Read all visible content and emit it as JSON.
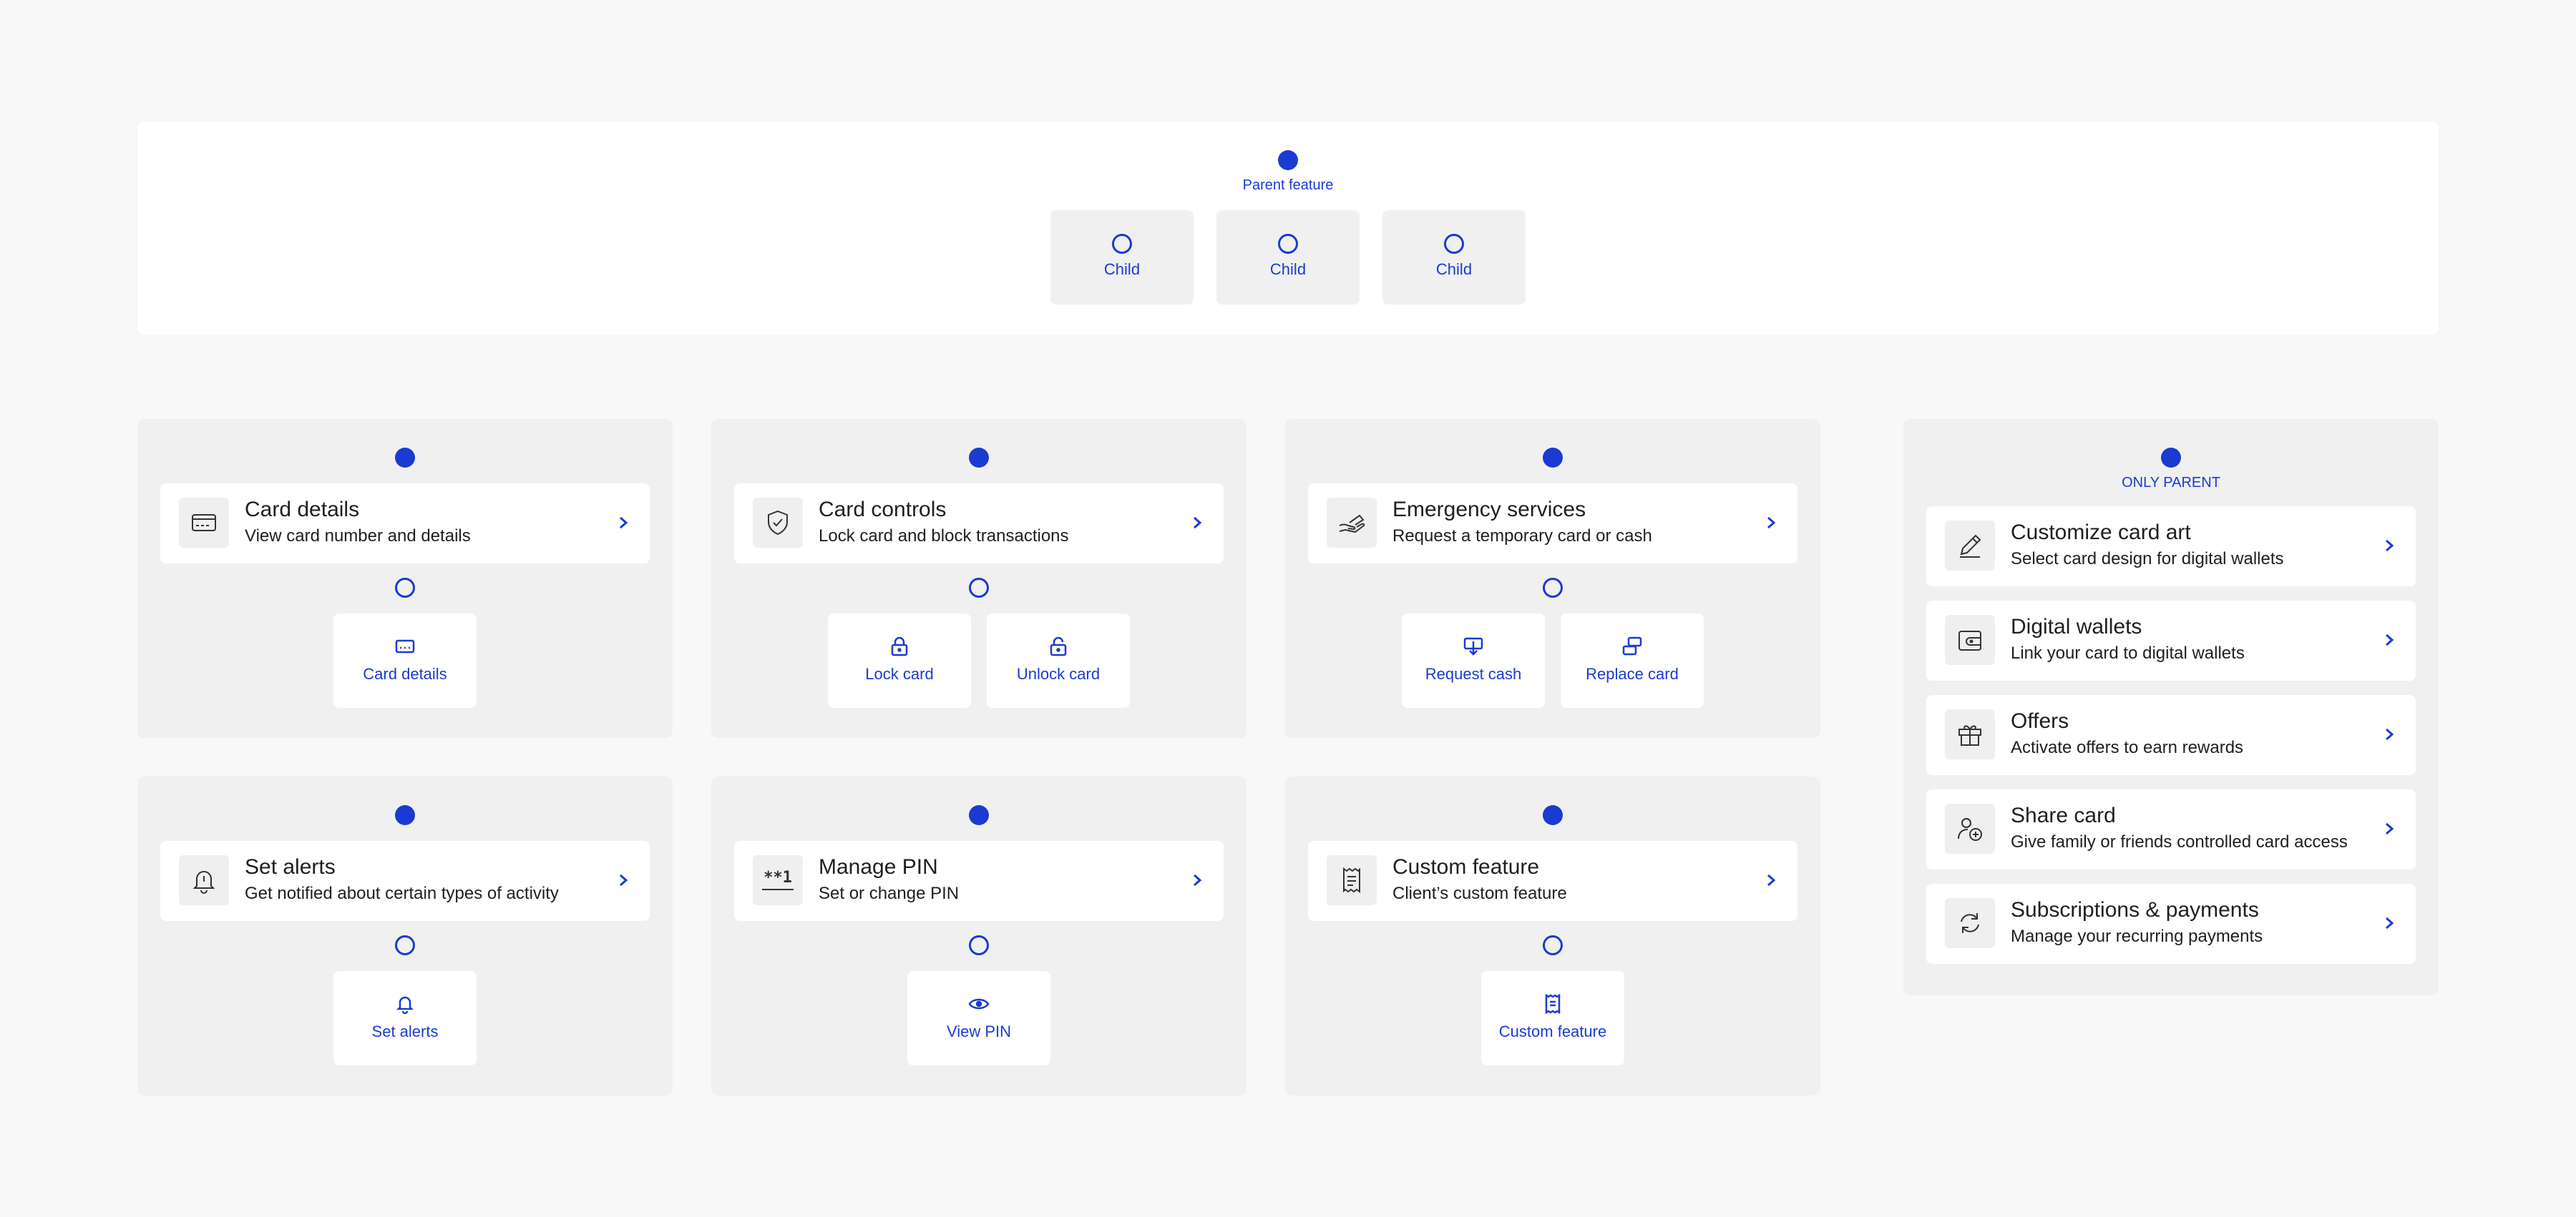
{
  "legend": {
    "parent_label": "Parent feature",
    "children": [
      "Child",
      "Child",
      "Child"
    ]
  },
  "groups": [
    {
      "title": "Card details",
      "subtitle": "View card number and details",
      "icon": "credit-card-icon",
      "children": [
        {
          "label": "Card details",
          "icon": "card-small-icon"
        }
      ]
    },
    {
      "title": "Card controls",
      "subtitle": "Lock card and block transactions",
      "icon": "shield-check-icon",
      "children": [
        {
          "label": "Lock card",
          "icon": "lock-icon"
        },
        {
          "label": "Unlock card",
          "icon": "unlock-icon"
        }
      ]
    },
    {
      "title": "Emergency services",
      "subtitle": "Request a temporary card or cash",
      "icon": "hand-card-icon",
      "children": [
        {
          "label": "Request cash",
          "icon": "cash-request-icon"
        },
        {
          "label": "Replace card",
          "icon": "replace-card-icon"
        }
      ]
    },
    {
      "title": "Set alerts",
      "subtitle": "Get notified about certain types of activity",
      "icon": "bell-icon",
      "children": [
        {
          "label": "Set alerts",
          "icon": "bell-small-icon"
        }
      ]
    },
    {
      "title": "Manage PIN",
      "subtitle": "Set or change PIN",
      "icon": "pin-icon",
      "pin_glyph": "**1",
      "children": [
        {
          "label": "View PIN",
          "icon": "eye-icon"
        }
      ]
    },
    {
      "title": "Custom feature",
      "subtitle": "Client’s custom feature",
      "icon": "receipt-icon",
      "children": [
        {
          "label": "Custom feature",
          "icon": "receipt-small-icon"
        }
      ]
    }
  ],
  "only_parent": {
    "label": "ONLY PARENT",
    "items": [
      {
        "title": "Customize card art",
        "subtitle": "Select card design for digital wallets",
        "icon": "pen-icon"
      },
      {
        "title": "Digital wallets",
        "subtitle": "Link your card to digital wallets",
        "icon": "wallet-icon"
      },
      {
        "title": "Offers",
        "subtitle": "Activate offers to earn rewards",
        "icon": "gift-icon"
      },
      {
        "title": "Share card",
        "subtitle": "Give family or friends controlled card access",
        "icon": "add-user-icon"
      },
      {
        "title": "Subscriptions & payments",
        "subtitle": "Manage your recurring payments",
        "icon": "refresh-icon"
      }
    ]
  },
  "colors": {
    "accent": "#1a3bd1",
    "background": "#f8f8f8",
    "panel": "#f0f0f0",
    "card": "#ffffff"
  }
}
